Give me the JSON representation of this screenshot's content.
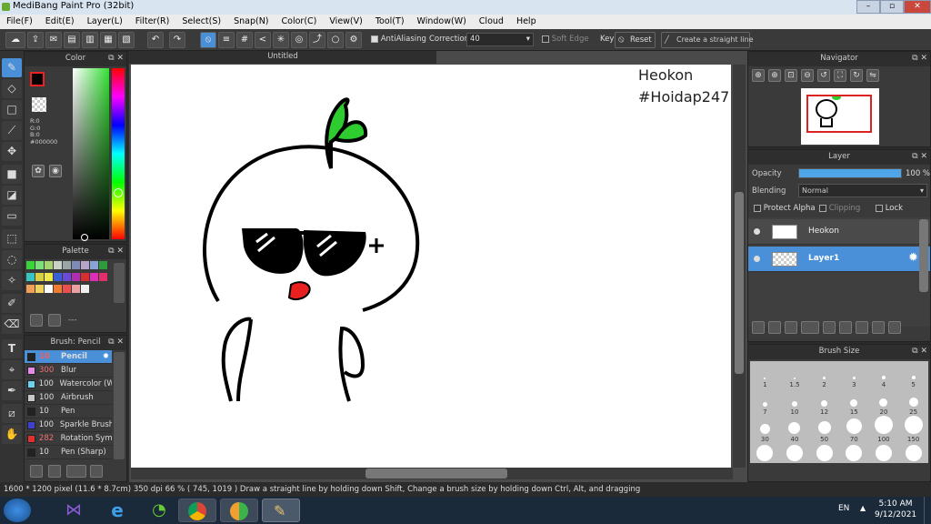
{
  "window": {
    "title": "MediBang Paint Pro (32bit)"
  },
  "menu": [
    "File(F)",
    "Edit(E)",
    "Layer(L)",
    "Filter(R)",
    "Select(S)",
    "Snap(N)",
    "Color(C)",
    "View(V)",
    "Tool(T)",
    "Window(W)",
    "Cloud",
    "Help"
  ],
  "toolbar": {
    "antialiasing_label": "AntiAliasing",
    "correction_label": "Correction",
    "correction_value": "40",
    "soft_edge_label": "Soft Edge",
    "key_label": "Key",
    "reset_label": "Reset",
    "straight_line_label": "Create a straight line"
  },
  "color_panel": {
    "title": "Color",
    "r": "R:0",
    "g": "G:0",
    "b": "B:0",
    "hex": "#000000",
    "fg_color": "#000000",
    "bg_color": "#ffffff"
  },
  "palette_panel": {
    "title": "Palette",
    "swatches": [
      "#3ad53a",
      "#7be07b",
      "#a4d36f",
      "#c8d0c8",
      "#9aa6a6",
      "#7d8bb6",
      "#b7a5c7",
      "#8aa3d6",
      "#2e9c3a",
      "#39c4c4",
      "#d6d045",
      "#f0e74b",
      "#3a5fd6",
      "#6b4bd6",
      "#b02fb0",
      "#d62f2f",
      "#dc2fb5",
      "#e02f6a",
      "#f0a05a",
      "#f0d25a",
      "#ffffff",
      "#f07a2f",
      "#e85050",
      "#e8a0a0",
      "#f0f0f0"
    ],
    "more_label": "---"
  },
  "brush_panel": {
    "title": "Brush: Pencil",
    "items": [
      {
        "size": "10",
        "name": "Pencil",
        "color": "#222222",
        "selected": true
      },
      {
        "size": "300",
        "name": "Blur",
        "color": "#e58ae6",
        "selected": false
      },
      {
        "size": "100",
        "name": "Watercolor (W",
        "color": "#6fd1f0",
        "selected": false
      },
      {
        "size": "100",
        "name": "Airbrush",
        "color": "#c8c8c8",
        "selected": false
      },
      {
        "size": "10",
        "name": "Pen",
        "color": "#222222",
        "selected": false
      },
      {
        "size": "100",
        "name": "Sparkle Brush",
        "color": "#4040d0",
        "selected": false
      },
      {
        "size": "282",
        "name": "Rotation Sym",
        "color": "#e03030",
        "selected": false
      },
      {
        "size": "10",
        "name": "Pen (Sharp)",
        "color": "#222222",
        "selected": false
      }
    ]
  },
  "canvas": {
    "tab": "Untitled",
    "text_line1": "Heokon",
    "text_line2": "#Hoidap247"
  },
  "navigator": {
    "title": "Navigator"
  },
  "layer_panel": {
    "title": "Layer",
    "opacity_label": "Opacity",
    "opacity_value": "100 %",
    "opacity_fraction": 1.0,
    "blending_label": "Blending",
    "blending_value": "Normal",
    "protect_alpha_label": "Protect Alpha",
    "clipping_label": "Clipping",
    "lock_label": "Lock",
    "layers": [
      {
        "name": "Heokon",
        "selected": false
      },
      {
        "name": "Layer1",
        "selected": true
      }
    ]
  },
  "brush_size_panel": {
    "title": "Brush Size",
    "sizes": [
      [
        "1",
        "1.5",
        "2",
        "3",
        "4",
        "5"
      ],
      [
        "7",
        "10",
        "12",
        "15",
        "20",
        "25"
      ],
      [
        "30",
        "40",
        "50",
        "70",
        "100",
        "150"
      ]
    ]
  },
  "status": {
    "text": "1600 * 1200 pixel   (11.6 * 8.7cm)   350 dpi   66 %   ( 745, 1019 )   Draw a straight line by holding down Shift, Change a brush size by holding down Ctrl, Alt, and dragging"
  },
  "taskbar": {
    "lang": "EN",
    "time": "5:10 AM",
    "date": "9/12/2021"
  }
}
